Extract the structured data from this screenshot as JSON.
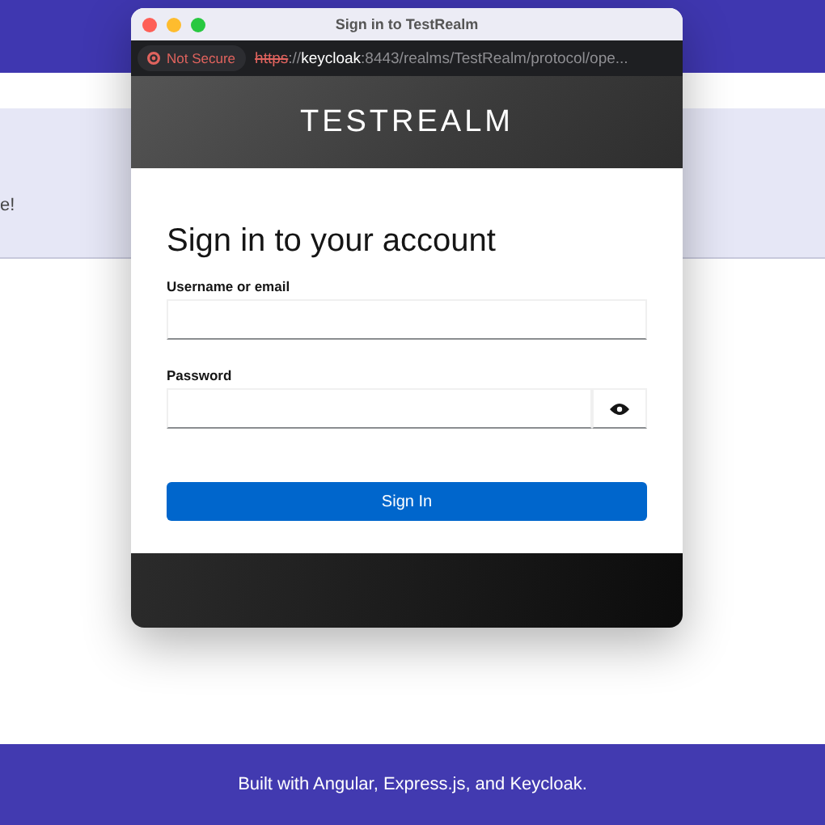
{
  "background_page": {
    "banner_text": "e!",
    "footer_text": "Built with Angular, Express.js, and Keycloak."
  },
  "popup": {
    "title": "Sign in to TestRealm",
    "security_badge": "Not Secure",
    "url": {
      "scheme": "https",
      "separator": "://",
      "host": "keycloak",
      "rest": ":8443/realms/TestRealm/protocol/ope..."
    },
    "realm_name": "TESTREALM",
    "heading": "Sign in to your account",
    "fields": [
      {
        "kind": "text",
        "label": "Username or email"
      },
      {
        "kind": "password",
        "label": "Password"
      }
    ],
    "submit": "Sign In"
  }
}
